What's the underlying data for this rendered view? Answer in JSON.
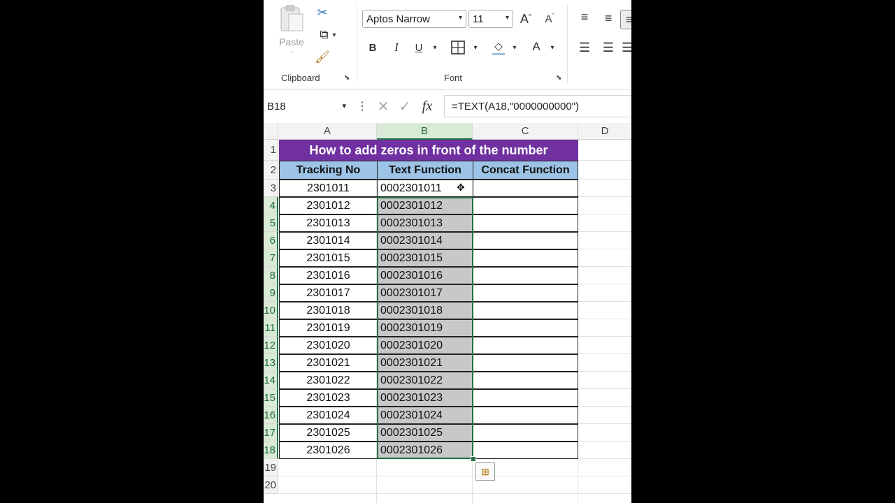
{
  "ribbon": {
    "clipboard": {
      "paste_label": "Paste",
      "group_label": "Clipboard"
    },
    "font": {
      "family": "Aptos Narrow",
      "size": "11",
      "bold": "B",
      "italic": "I",
      "underline": "U",
      "font_color_glyph": "A",
      "group_label": "Font"
    }
  },
  "formula_bar": {
    "name_box": "B18",
    "fx": "fx",
    "formula": "=TEXT(A18,\"0000000000\")"
  },
  "sheet": {
    "columns": [
      "A",
      "B",
      "C",
      "D"
    ],
    "selected_column": "B",
    "row_numbers": [
      "1",
      "2",
      "3",
      "4",
      "5",
      "6",
      "7",
      "8",
      "9",
      "10",
      "11",
      "12",
      "13",
      "14",
      "15",
      "16",
      "17",
      "18",
      "19",
      "20"
    ],
    "title": "How to add zeros in front of the number",
    "headers": [
      "Tracking No",
      "Text Function",
      "Concat Function"
    ],
    "rows": [
      {
        "tracking": "2301011",
        "text": "0002301011",
        "concat": ""
      },
      {
        "tracking": "2301012",
        "text": "0002301012",
        "concat": ""
      },
      {
        "tracking": "2301013",
        "text": "0002301013",
        "concat": ""
      },
      {
        "tracking": "2301014",
        "text": "0002301014",
        "concat": ""
      },
      {
        "tracking": "2301015",
        "text": "0002301015",
        "concat": ""
      },
      {
        "tracking": "2301016",
        "text": "0002301016",
        "concat": ""
      },
      {
        "tracking": "2301017",
        "text": "0002301017",
        "concat": ""
      },
      {
        "tracking": "2301018",
        "text": "0002301018",
        "concat": ""
      },
      {
        "tracking": "2301019",
        "text": "0002301019",
        "concat": ""
      },
      {
        "tracking": "2301020",
        "text": "0002301020",
        "concat": ""
      },
      {
        "tracking": "2301021",
        "text": "0002301021",
        "concat": ""
      },
      {
        "tracking": "2301022",
        "text": "0002301022",
        "concat": ""
      },
      {
        "tracking": "2301023",
        "text": "0002301023",
        "concat": ""
      },
      {
        "tracking": "2301024",
        "text": "0002301024",
        "concat": ""
      },
      {
        "tracking": "2301025",
        "text": "0002301025",
        "concat": ""
      },
      {
        "tracking": "2301026",
        "text": "0002301026",
        "concat": ""
      }
    ]
  },
  "colors": {
    "title_fill": "#7030a0",
    "header_fill": "#9dc3e6",
    "selection_fill": "#c8c8c8",
    "selection_border": "#217346"
  }
}
